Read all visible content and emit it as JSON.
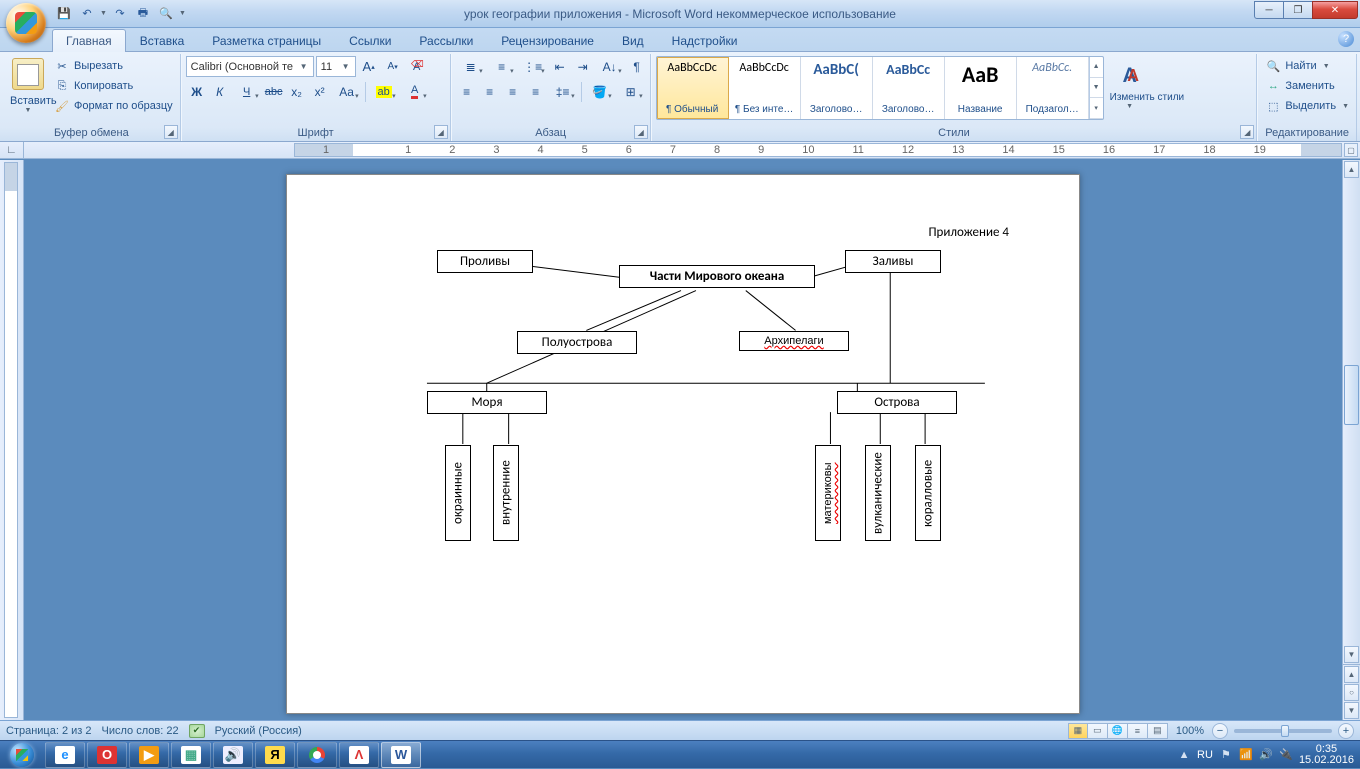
{
  "window": {
    "title": "урок географии приложения - Microsoft Word некоммерческое использование"
  },
  "qat": {
    "save": "💾",
    "undo": "↶",
    "redo": "↷",
    "print": "🖶",
    "preview": "🔍"
  },
  "tabs": [
    "Главная",
    "Вставка",
    "Разметка страницы",
    "Ссылки",
    "Рассылки",
    "Рецензирование",
    "Вид",
    "Надстройки"
  ],
  "ribbon": {
    "clipboard": {
      "paste": "Вставить",
      "cut": "Вырезать",
      "copy": "Копировать",
      "fmt": "Формат по образцу",
      "label": "Буфер обмена"
    },
    "font": {
      "family": "Calibri (Основной те",
      "size": "11",
      "label": "Шрифт",
      "btns": {
        "bold": "Ж",
        "italic": "К",
        "underline": "Ч",
        "strike": "abc",
        "sub": "x₂",
        "sup": "x²",
        "case": "Aa",
        "clear": "A̷",
        "hilite": "ab",
        "color": "A",
        "grow": "A",
        "shrink": "A"
      }
    },
    "para": {
      "label": "Абзац"
    },
    "styles": {
      "label": "Стили",
      "change": "Изменить стили",
      "items": [
        {
          "preview": "AaBbCcDc",
          "size": "12px",
          "label": "¶ Обычный",
          "sel": true
        },
        {
          "preview": "AaBbCcDc",
          "size": "12px",
          "label": "¶ Без инте…"
        },
        {
          "preview": "AaBbC(",
          "size": "15px",
          "color": "#2a5a9a",
          "label": "Заголово…"
        },
        {
          "preview": "AaBbCc",
          "size": "14px",
          "color": "#2a5a9a",
          "label": "Заголово…"
        },
        {
          "preview": "AaB",
          "size": "22px",
          "label": "Название"
        },
        {
          "preview": "AaBbCc.",
          "size": "12px",
          "style": "italic",
          "color": "#5a7aa5",
          "label": "Подзагол…"
        }
      ]
    },
    "edit": {
      "find": "Найти",
      "replace": "Заменить",
      "select": "Выделить",
      "label": "Редактирование"
    }
  },
  "document": {
    "appx": "Приложение 4",
    "boxes": {
      "straits": "Проливы",
      "bays": "Заливы",
      "center": "Части Мирового океана",
      "penins": "Полуострова",
      "arch": "Архипелаги",
      "seas": "Моря",
      "islands": "Острова",
      "seas_sub": [
        "окраинные",
        "внутренние"
      ],
      "isl_sub": [
        "материковы",
        "вулканические",
        "коралловые"
      ]
    }
  },
  "ruler": {
    "nums": [
      "1",
      "",
      "1",
      "2",
      "3",
      "4",
      "5",
      "6",
      "7",
      "8",
      "9",
      "10",
      "11",
      "12",
      "13",
      "14",
      "15",
      "16",
      "17",
      "18",
      "19"
    ]
  },
  "status": {
    "page": "Страница: 2 из 2",
    "words": "Число слов: 22",
    "lang": "Русский (Россия)",
    "zoom": "100%"
  },
  "taskbar": {
    "items": [
      {
        "ic": "e",
        "c": "#1e90ff",
        "bg": "#fff"
      },
      {
        "ic": "O",
        "c": "#fff",
        "bg": "#d33"
      },
      {
        "ic": "▶",
        "c": "#fff",
        "bg": "#f39c12"
      },
      {
        "ic": "▦",
        "c": "#4a8",
        "bg": "#fff"
      },
      {
        "ic": "🔊",
        "c": "#48c",
        "bg": "#eef"
      },
      {
        "ic": "Я",
        "c": "#000",
        "bg": "#ffdb4d"
      },
      {
        "ic": "",
        "chrome": true
      },
      {
        "ic": "Λ",
        "c": "#d33",
        "bg": "#fff"
      },
      {
        "ic": "W",
        "c": "#2b579a",
        "bg": "#fff",
        "active": true
      }
    ],
    "time": "0:35",
    "date": "15.02.2016",
    "lang": "RU"
  }
}
